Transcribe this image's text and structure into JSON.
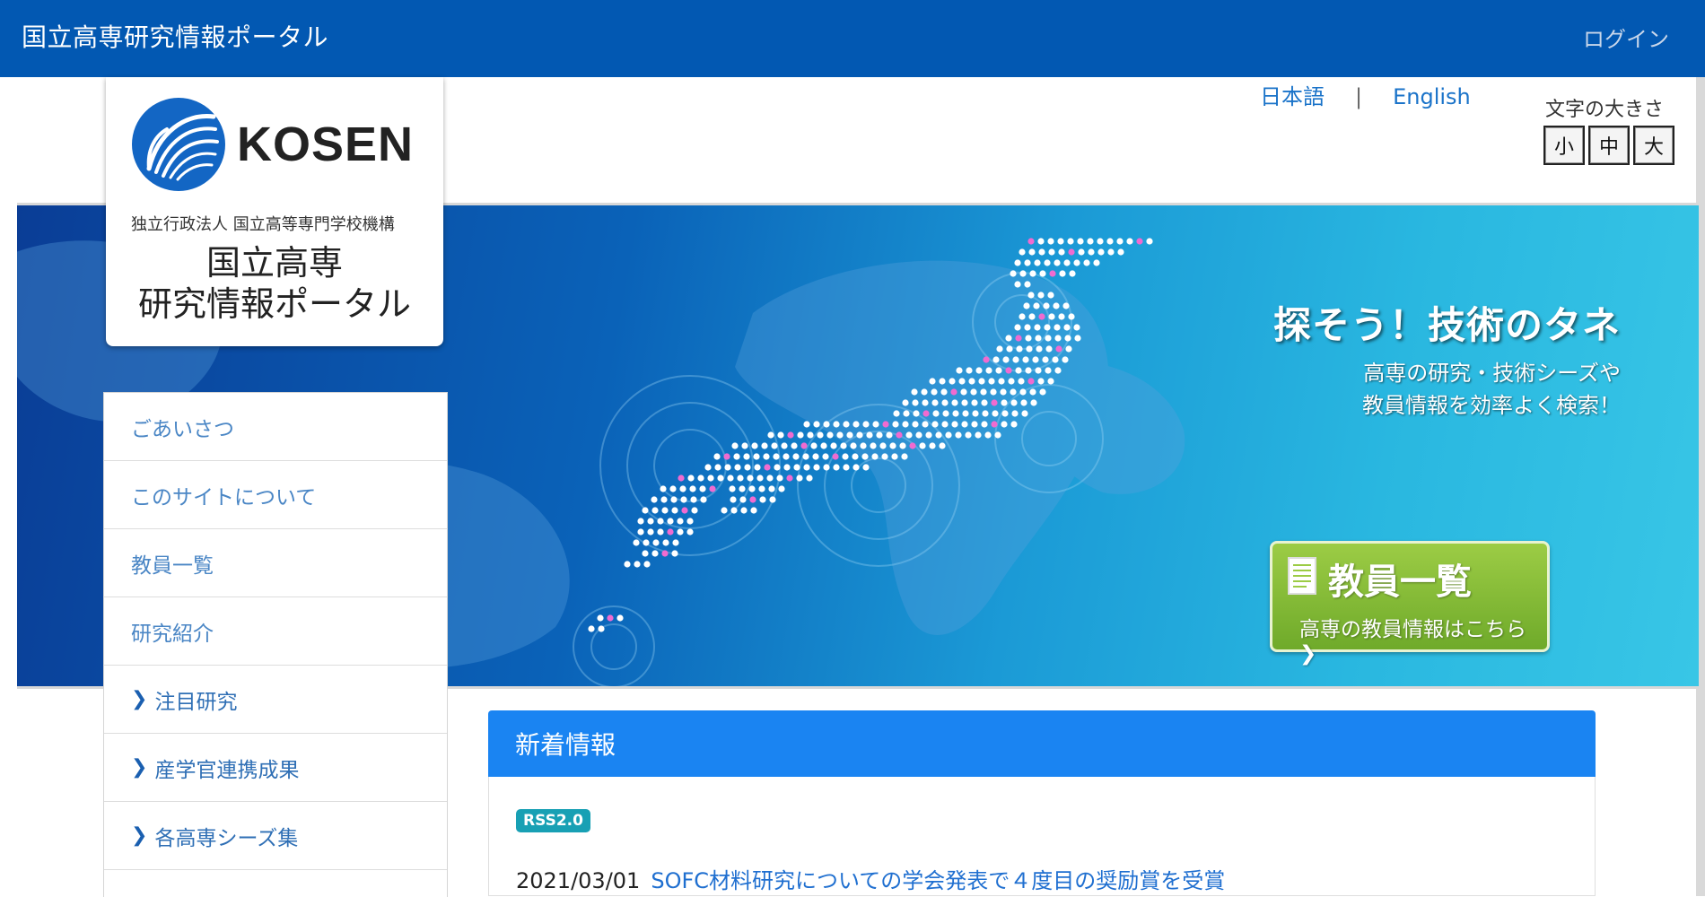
{
  "navbar": {
    "brand": "国立高専研究情報ポータル",
    "login": "ログイン"
  },
  "lang": {
    "ja": "日本語",
    "sep": "|",
    "en": "English"
  },
  "font_size": {
    "label": "文字の大きさ",
    "small": "小",
    "medium": "中",
    "large": "大"
  },
  "logo": {
    "wordmark": "KOSEN",
    "org": "独立行政法人 国立高等専門学校機構",
    "name_line1": "国立高専",
    "name_line2": "研究情報ポータル"
  },
  "hero": {
    "catch_title": "探そう！技術のタネ",
    "catch_sub1": "高専の研究・技術シーズや",
    "catch_sub2": "教員情報を効率よく検索！",
    "button_title": "教員一覧",
    "button_sub": "高専の教員情報はこちら ❯"
  },
  "sidebar": {
    "items": [
      {
        "label": "ごあいさつ"
      },
      {
        "label": "このサイトについて"
      },
      {
        "label": "教員一覧"
      },
      {
        "label": "研究紹介"
      },
      {
        "label": "注目研究"
      },
      {
        "label": "産学官連携成果"
      },
      {
        "label": "各高専シーズ集"
      }
    ]
  },
  "news": {
    "header": "新着情報",
    "rss": "RSS2.0",
    "items": [
      {
        "date": "2021/03/01",
        "title": "SOFC材料研究についての学会発表で４度目の奨励賞を受賞"
      }
    ]
  },
  "colors": {
    "navbar": "#0258b2",
    "news_header": "#1a84f2",
    "button_green": "#7cb434"
  }
}
